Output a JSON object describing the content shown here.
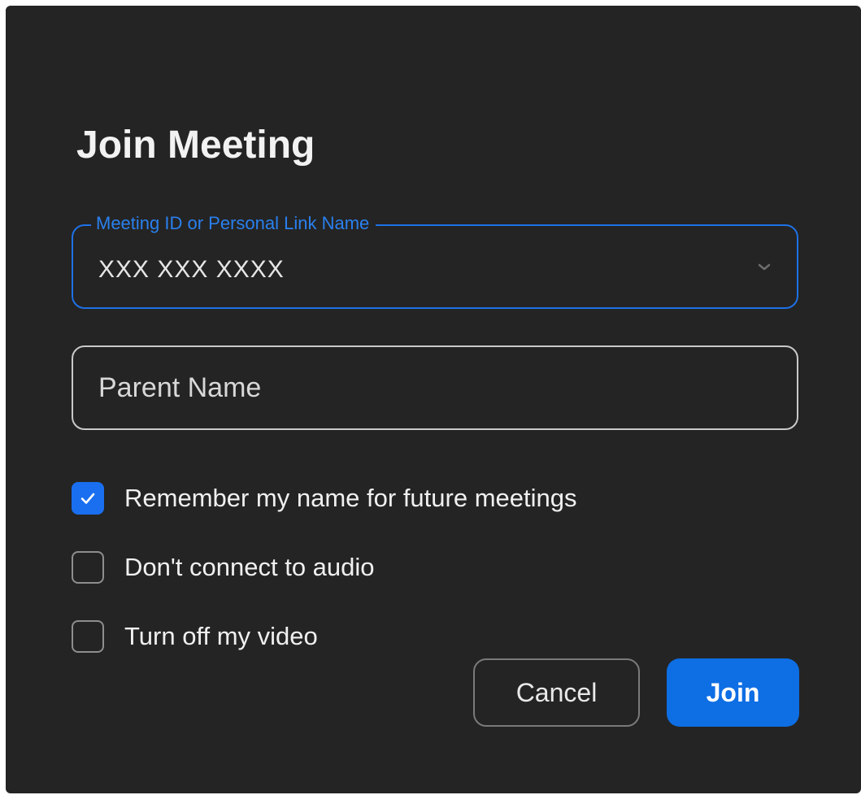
{
  "dialog": {
    "title": "Join Meeting"
  },
  "meeting_id_field": {
    "label": "Meeting ID or Personal Link Name",
    "value": "XXX XXX XXXX",
    "dropdown_icon": "chevron-down-icon"
  },
  "name_field": {
    "value": "",
    "placeholder": "Parent Name"
  },
  "options": [
    {
      "label": "Remember my name for future meetings",
      "checked": true,
      "icon": "checkmark-icon"
    },
    {
      "label": "Don't connect to audio",
      "checked": false
    },
    {
      "label": "Turn off my video",
      "checked": false
    }
  ],
  "buttons": {
    "cancel_label": "Cancel",
    "join_label": "Join"
  },
  "colors": {
    "background": "#242424",
    "accent": "#0e6ee4",
    "focus_border": "#1e71e6",
    "text": "#f0f0f0"
  }
}
